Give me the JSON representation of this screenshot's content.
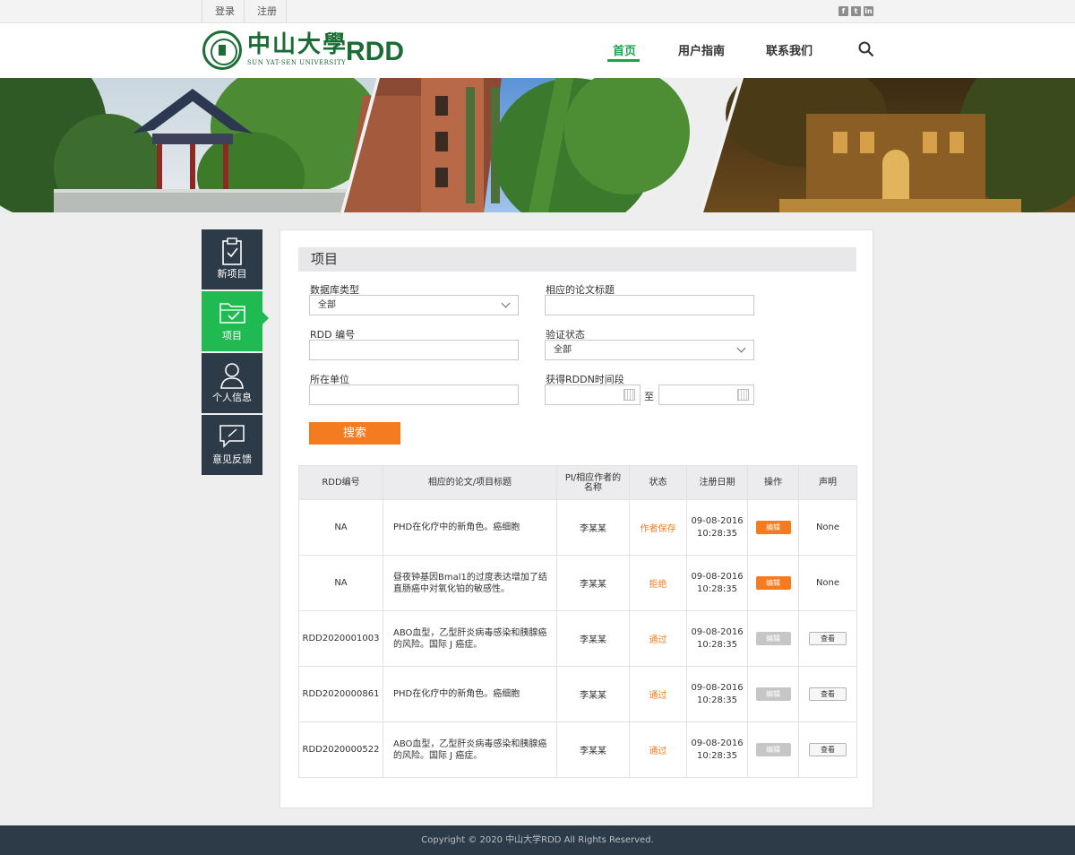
{
  "topbar": {
    "login": "登录",
    "register": "注册",
    "social": [
      "f",
      "t",
      "in"
    ]
  },
  "header": {
    "logo_cn": "中山大學",
    "logo_en": "SUN YAT-SEN UNIVERSITY",
    "logo_rdd": "RDD",
    "nav": [
      "首页",
      "用户指南",
      "联系我们"
    ]
  },
  "sidebar": {
    "items": [
      "新项目",
      "项目",
      "个人信息",
      "意见反馈"
    ]
  },
  "panel": {
    "title": "项目",
    "fields": {
      "db_type_label": "数据库类型",
      "db_type_value": "全部",
      "paper_title_label": "相应的论文标题",
      "rdd_id_label": "RDD 编号",
      "verify_label": "验证状态",
      "verify_value": "全部",
      "unit_label": "所在单位",
      "period_label": "获得RDDN时间段",
      "to": "至"
    },
    "search_btn": "搜索"
  },
  "table": {
    "headers": [
      "RDD编号",
      "相应的论文/项目标题",
      "PI/相应作者的名称",
      "状态",
      "注册日期",
      "操作",
      "声明"
    ],
    "rows": [
      {
        "id": "NA",
        "title": "PHD在化疗中的新角色。癌细胞",
        "pi": "李某某",
        "status": "作者保存",
        "date": "09-08-2016",
        "time": "10:28:35",
        "op": "编辑",
        "decl": "None"
      },
      {
        "id": "NA",
        "title": "昼夜钟基因Bmal1的过度表达增加了结直肠癌中对氧化铂的敏感性。",
        "pi": "李某某",
        "status": "拒绝",
        "date": "09-08-2016",
        "time": "10:28:35",
        "op": "编辑",
        "decl": "None"
      },
      {
        "id": "RDD2020001003",
        "title": "ABO血型，乙型肝炎病毒感染和胰腺癌的风险。国际 J 癌症。",
        "pi": "李某某",
        "status": "通过",
        "date": "09-08-2016",
        "time": "10:28:35",
        "op": "编辑",
        "decl": "查看"
      },
      {
        "id": "RDD2020000861",
        "title": "PHD在化疗中的新角色。癌细胞",
        "pi": "李某某",
        "status": "通过",
        "date": "09-08-2016",
        "time": "10:28:35",
        "op": "编辑",
        "decl": "查看"
      },
      {
        "id": "RDD2020000522",
        "title": "ABO血型，乙型肝炎病毒感染和胰腺癌的风险。国际 J 癌症。",
        "pi": "李某某",
        "status": "通过",
        "date": "09-08-2016",
        "time": "10:28:35",
        "op": "编辑",
        "decl": "查看"
      }
    ]
  },
  "footer": {
    "copyright": "Copyright © 2020 中山大学RDD All Rights Reserved."
  },
  "colors": {
    "brand_green": "#1a6c34",
    "active_green": "#1fbb52",
    "accent_orange": "#f47b20",
    "dark_navy": "#2d3a47"
  }
}
